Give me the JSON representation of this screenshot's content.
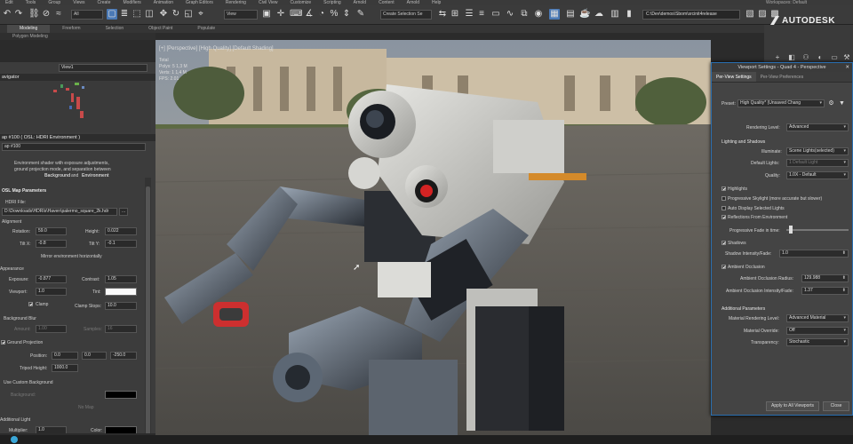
{
  "menu": [
    "Edit",
    "Tools",
    "Group",
    "Views",
    "Create",
    "Modifiers",
    "Animation",
    "Graph Editors",
    "Rendering",
    "Civil View",
    "Customize",
    "Scripting",
    "Arnold",
    "Content",
    "Arnold",
    "Help"
  ],
  "workspaces_label": "Workspaces: Default",
  "toolbar": {
    "filter_value": "All",
    "view_value": "View",
    "selection_set": "Create Selection Se",
    "path_value": "C:\\Dev\\demos\\Sbom\\srcinit4release"
  },
  "brand": "AUTODESK",
  "ribbon_tabs": [
    "Modeling",
    "Freeform",
    "Selection",
    "Object Paint",
    "Populate"
  ],
  "ribbon_sub": "Polygon Modeling",
  "left_panel": {
    "view_field": "View1",
    "navigator_header": "avigator",
    "map_header": "ap #100 ( OSL: HDRI Environment )",
    "map_name": "ap #100",
    "description_line1": "Environment shader with exposure adjustments,",
    "description_line2": "ground projection mode, and separation between",
    "description_line3_a": "Background",
    "description_line3_and": "and",
    "description_line3_b": "Environment",
    "params_header": "OSL Map Parameters",
    "hdri_label": "HDRI File:",
    "hdri_path": "D:\\Downloads\\HDRIs\\Haven\\palermo_square_2k.hdr",
    "hdri_btn": "...",
    "alignment": "Alignment",
    "rotation_label": "Rotation:",
    "rotation_value": "59.0",
    "height_label": "Height:",
    "height_value": "0.022",
    "tiltx_label": "Tilt X:",
    "tiltx_value": "-0.8",
    "tilty_label": "Tilt Y:",
    "tilty_value": "-0.1",
    "mirror_btn": "Mirror environment horizontally",
    "appearance": "Appearance",
    "exposure_label": "Exposure:",
    "exposure_value": "-0.877",
    "contrast_label": "Contrast:",
    "contrast_value": "1.05",
    "viewport_label": "Viewport:",
    "viewport_value": "1.0",
    "tint_label": "Tint:",
    "clamp_label": "Clamp",
    "clampstops_label": "Clamp Stops:",
    "clampstops_value": "10.0",
    "bgblur": "Background Blur",
    "amount_label": "Amount:",
    "amount_value": "1.00",
    "samples_label": "Samples:",
    "samples_value": "16",
    "groundproj": "Ground Projection",
    "position_label": "Position:",
    "pos_x": "0.0",
    "pos_y": "0.0",
    "pos_z": "-250.0",
    "tripod_label": "Tripod Height:",
    "tripod_value": "1000.0",
    "usecustombg": "Use Custom Background",
    "bg_label": "Background:",
    "nomap": "No Map",
    "additional": "Additional Light",
    "multiplier_label": "Multiplier:",
    "multiplier_value": "1.0",
    "color_label": "Color:"
  },
  "viewport": {
    "label": "[+] [Perspective] [High Quality] [Default Shading]",
    "stats": [
      "Total",
      "Polys: 5 1,3 M",
      "Verts: 1 1,4 M",
      "FPS: 2.01"
    ]
  },
  "dialog": {
    "title": "Viewport Settings - Quad 4 - Perspective",
    "tab_active": "Per-View Settings",
    "tab_inactive": "Per-View Preferences",
    "preset_label": "Preset:",
    "preset_value": "High Quality* (Unsaved Chang",
    "rendering_level_label": "Rendering Level:",
    "rendering_level_value": "Advanced",
    "lighting_section": "Lighting and Shadows",
    "illuminate_label": "Illuminate:",
    "illuminate_value": "Scene Lights(selected)",
    "default_lights_label": "Default Lights:",
    "default_lights_value": "1 Default Light",
    "quality_label": "Quality:",
    "quality_value": "1.0X - Default",
    "highlights": "Highlights",
    "progressive": "Progressive Skylight (more accurate but slower)",
    "auto_display": "Auto Display Selected Lights",
    "reflections": "Reflections From Environment",
    "fade_label": "Progressive Fade in time:",
    "shadows": "Shadows",
    "shadow_intensity_label": "Shadow Intensity/Fade:",
    "shadow_intensity_value": "1.0",
    "ambient": "Ambient Occlusion",
    "ao_radius_label": "Ambient Occlusion Radius:",
    "ao_radius_value": "129.988",
    "ao_intensity_label": "Ambient Occlusion Intensity/Fade:",
    "ao_intensity_value": "1.37",
    "additional_section": "Additional Parameters",
    "mat_level_label": "Material Rendering Level:",
    "mat_level_value": "Advanced Material",
    "mat_override_label": "Material Override:",
    "mat_override_value": "Off",
    "transparency_label": "Transparency:",
    "transparency_value": "Stochastic",
    "apply_btn": "Apply to All Viewports",
    "close_btn": "Close"
  },
  "colors": {
    "accent": "#4a79b5",
    "dialog_border": "#2a6fb0",
    "panel_bg": "#3c3c3c"
  }
}
